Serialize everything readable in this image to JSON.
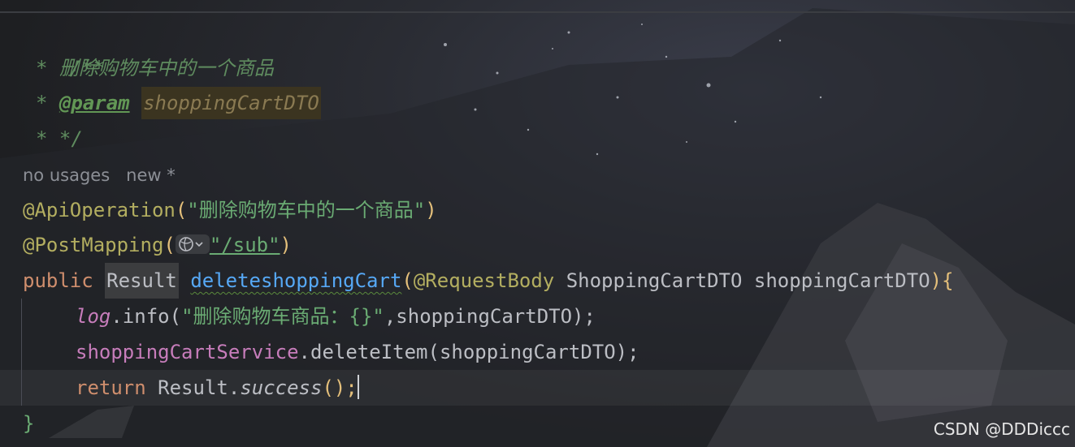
{
  "code": {
    "doc_open": "/**",
    "doc_summary": "删除购物车中的一个商品",
    "doc_param_tag": "@param",
    "doc_param_name": "shoppingCartDTO",
    "doc_close": "*/",
    "hint_usages": "no usages",
    "hint_new": "new *",
    "ann_api": "@ApiOperation",
    "ann_api_value": "\"删除购物车中的一个商品\"",
    "ann_post": "@PostMapping",
    "ann_post_value": "\"/sub\"",
    "kw_public": "public",
    "type_result": "Result",
    "method_name": "deleteshoppingCart",
    "ann_body": "@RequestBody",
    "param_type": "ShoppingCartDTO",
    "param_name": "shoppingCartDTO",
    "log_field": "log",
    "log_method": ".info(",
    "log_str": "\"删除购物车商品：{}\"",
    "log_arg": ",shoppingCartDTO);",
    "service_field": "shoppingCartService",
    "service_call": ".deleteItem(shoppingCartDTO);",
    "kw_return": "return",
    "return_class": "Result.",
    "return_method": "success",
    "return_tail": "();",
    "closing_brace": "}"
  },
  "watermark": "CSDN @DDDiccc",
  "colors": {
    "background": "#1e1f22",
    "keyword": "#cf8e6d",
    "string": "#6aab73",
    "annotation": "#b3ae60",
    "method": "#56a8f5",
    "field": "#c77dbb",
    "doc_comment": "#5f8c5f"
  }
}
